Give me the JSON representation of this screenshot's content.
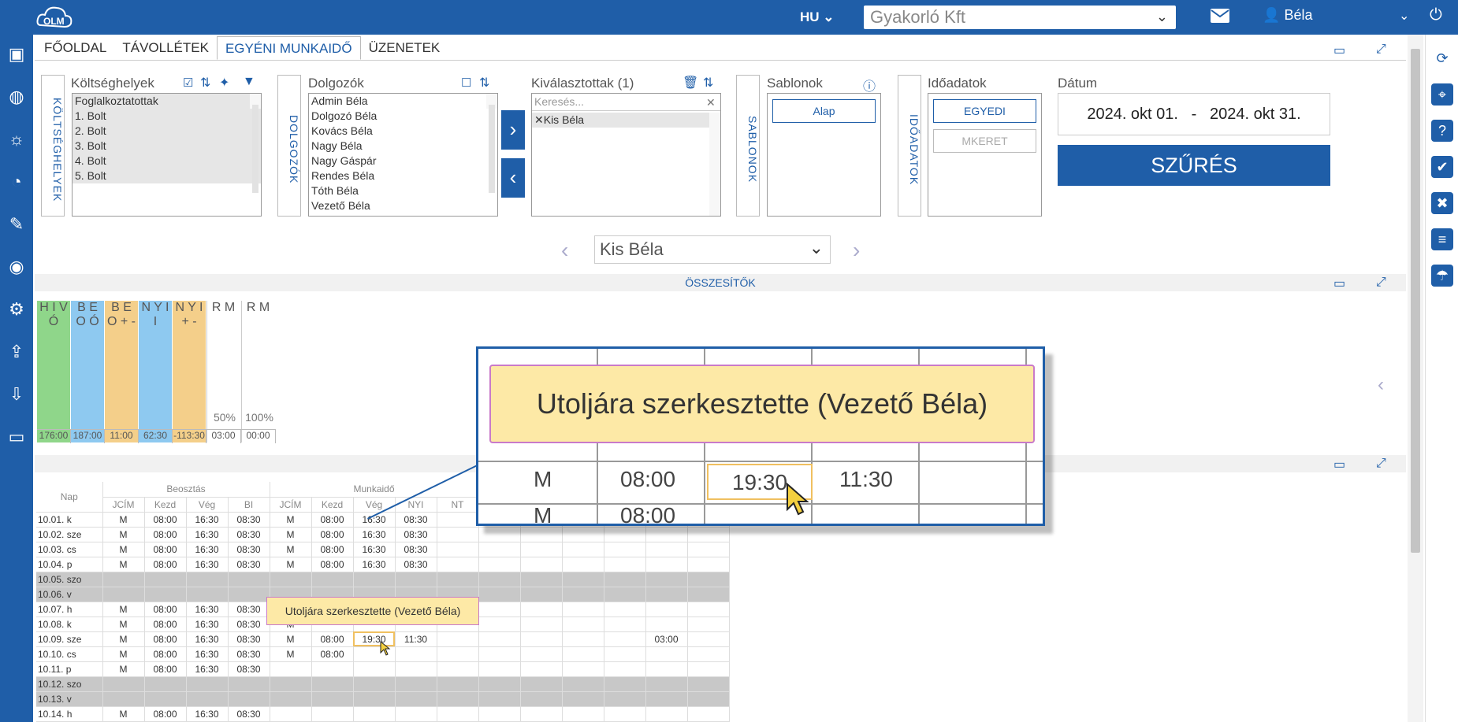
{
  "brand": {
    "logo_text": "OLM"
  },
  "header": {
    "lang": "HU",
    "company": "Gyakorló Kft",
    "user": "Béla"
  },
  "tabs": [
    "FŐOLDAL",
    "TÁVOLLÉTEK",
    "EGYÉNI MUNKAIDŐ",
    "ÜZENETEK"
  ],
  "filters": {
    "koltseg": {
      "title": "Költséghelyek",
      "vlabel": "KÖLTSÉGHELYEK",
      "items": [
        "Foglalkoztatottak",
        "1. Bolt",
        "2. Bolt",
        "3. Bolt",
        "4. Bolt",
        "5. Bolt"
      ]
    },
    "dolgozok": {
      "title": "Dolgozók",
      "vlabel": "DOLGOZÓK",
      "items": [
        "Admin Béla",
        "Dolgozó Béla",
        "Kovács Béla",
        "Nagy Béla",
        "Nagy Gáspár",
        "Rendes Béla",
        "Tóth Béla",
        "Vezető Béla"
      ]
    },
    "kivalasztottak": {
      "title": "Kiválasztottak (1)",
      "search_placeholder": "Keresés...",
      "items": [
        "Kis Béla"
      ]
    },
    "sablonok": {
      "title": "Sablonok",
      "vlabel": "SABLONOK",
      "button": "Alap"
    },
    "idoadatok": {
      "title": "Időadatok",
      "vlabel": "IDŐADATOK",
      "buttons": [
        "EGYEDI",
        "MKERET"
      ]
    },
    "datum": {
      "title": "Dátum",
      "from": "2024. okt 01.",
      "sep": "-",
      "to": "2024. okt 31."
    },
    "submit": "SZŰRÉS"
  },
  "employee_selector": "Kis Béla",
  "summary": {
    "title": "ÖSSZESÍTŐK",
    "columns": [
      {
        "label": "H I V Ó",
        "value": "176:00",
        "color": "#8fd68a"
      },
      {
        "label": "B E O Ó",
        "value": "187:00",
        "color": "#8ec9f0"
      },
      {
        "label": "B E O + -",
        "value": "11:00",
        "color": "#f4cf8a"
      },
      {
        "label": "N Y I I",
        "value": "62:30",
        "color": "#8ec9f0"
      },
      {
        "label": "N Y I + -",
        "value": "-113:30",
        "color": "#f4cf8a"
      },
      {
        "label": "R M",
        "pct": "50%",
        "value": "03:00",
        "color": "#ffffff"
      },
      {
        "label": "R M",
        "pct": "100%",
        "value": "00:00",
        "color": "#ffffff"
      }
    ]
  },
  "grid": {
    "group_headers": [
      "Beosztás",
      "Munkaidő"
    ],
    "day_header": "Nap",
    "col_headers": [
      "JCÍM",
      "Kezd",
      "Vég",
      "BI",
      "JCÍM",
      "Kezd",
      "Vég",
      "NYI",
      "NT"
    ],
    "rows": [
      {
        "day": "10.01. k",
        "c": [
          "M",
          "08:00",
          "16:30",
          "08:30",
          "M",
          "08:00",
          "16:30",
          "08:30",
          ""
        ],
        "extra": ""
      },
      {
        "day": "10.02. sze",
        "c": [
          "M",
          "08:00",
          "16:30",
          "08:30",
          "M",
          "08:00",
          "16:30",
          "08:30",
          ""
        ],
        "extra": ""
      },
      {
        "day": "10.03. cs",
        "c": [
          "M",
          "08:00",
          "16:30",
          "08:30",
          "M",
          "08:00",
          "16:30",
          "08:30",
          ""
        ],
        "extra": ""
      },
      {
        "day": "10.04. p",
        "c": [
          "M",
          "08:00",
          "16:30",
          "08:30",
          "M",
          "08:00",
          "16:30",
          "08:30",
          ""
        ],
        "extra": ""
      },
      {
        "day": "10.05. szo",
        "weekend": true,
        "c": [
          "",
          "",
          "",
          "",
          "",
          "",
          "",
          "",
          ""
        ],
        "extra": ""
      },
      {
        "day": "10.06. v",
        "weekend": true,
        "c": [
          "",
          "",
          "",
          "",
          "",
          "",
          "",
          "",
          ""
        ],
        "extra": ""
      },
      {
        "day": "10.07. h",
        "c": [
          "M",
          "08:00",
          "16:30",
          "08:30",
          "",
          "",
          "",
          "",
          ""
        ],
        "extra": ""
      },
      {
        "day": "10.08. k",
        "c": [
          "M",
          "08:00",
          "16:30",
          "08:30",
          "M",
          "",
          "",
          "",
          ""
        ],
        "extra": ""
      },
      {
        "day": "10.09. sze",
        "c": [
          "M",
          "08:00",
          "16:30",
          "08:30",
          "M",
          "08:00",
          "19:30",
          "11:30",
          ""
        ],
        "extra": "03:00"
      },
      {
        "day": "10.10. cs",
        "c": [
          "M",
          "08:00",
          "16:30",
          "08:30",
          "M",
          "08:00",
          "",
          "",
          ""
        ],
        "extra": ""
      },
      {
        "day": "10.11. p",
        "c": [
          "M",
          "08:00",
          "16:30",
          "08:30",
          "",
          "",
          "",
          "",
          ""
        ],
        "extra": ""
      },
      {
        "day": "10.12. szo",
        "weekend": true,
        "c": [
          "",
          "",
          "",
          "",
          "",
          "",
          "",
          "",
          ""
        ],
        "extra": ""
      },
      {
        "day": "10.13. v",
        "weekend": true,
        "c": [
          "",
          "",
          "",
          "",
          "",
          "",
          "",
          "",
          ""
        ],
        "extra": ""
      },
      {
        "day": "10.14. h",
        "c": [
          "M",
          "08:00",
          "16:30",
          "08:30",
          "",
          "",
          "",
          "",
          ""
        ],
        "extra": ""
      }
    ]
  },
  "tooltip": "Utoljára szerkesztette (Vezető Béla)",
  "zoom": {
    "tooltip": "Utoljára szerkesztette (Vezető Béla)",
    "row1": [
      "M",
      "08:00",
      "19:30",
      "11:30"
    ],
    "row2": [
      "M",
      "08:00"
    ]
  }
}
